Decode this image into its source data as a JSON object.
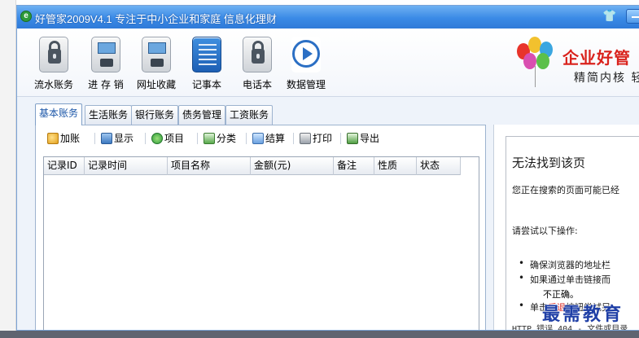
{
  "window": {
    "title": "好管家2009V4.1 专注于中小企业和家庭 信息化理财",
    "logo_letter": "e"
  },
  "toolbar": {
    "items": [
      {
        "label": "流水账务",
        "icon": "lock-icon"
      },
      {
        "label": "进 存 销",
        "icon": "storage-icon"
      },
      {
        "label": "网址收藏",
        "icon": "storage-icon"
      },
      {
        "label": "记事本",
        "icon": "notebook-icon"
      },
      {
        "label": "电话本",
        "icon": "lock-icon"
      },
      {
        "label": "数据管理",
        "icon": "play-icon"
      }
    ]
  },
  "brand": {
    "name": "企业好管",
    "slogan": "精简内核 轻"
  },
  "tabs": [
    {
      "label": "基本账务",
      "active": true
    },
    {
      "label": "生活账务",
      "active": false
    },
    {
      "label": "银行账务",
      "active": false
    },
    {
      "label": "债务管理",
      "active": false
    },
    {
      "label": "工资账务",
      "active": false
    }
  ],
  "subtoolbar": {
    "items": [
      {
        "label": "加账",
        "icon": "add-icon"
      },
      {
        "label": "显示",
        "icon": "display-icon"
      },
      {
        "label": "项目",
        "icon": "refresh-icon"
      },
      {
        "label": "分类",
        "icon": "excel-icon"
      },
      {
        "label": "结算",
        "icon": "settle-icon"
      },
      {
        "label": "打印",
        "icon": "print-icon"
      },
      {
        "label": "导出",
        "icon": "export-icon"
      }
    ]
  },
  "grid": {
    "columns": [
      "记录ID",
      "记录时间",
      "项目名称",
      "金额(元)",
      "备注",
      "性质",
      "状态"
    ]
  },
  "browser": {
    "error_title": "无法找到该页",
    "error_desc": "您正在搜索的页面可能已经",
    "try_text": "请尝试以下操作:",
    "bullets": [
      "确保浏览器的地址栏",
      "如果通过单击链接而",
      "单击后退按钮尝试另"
    ],
    "bullet2_cont": "不正确。",
    "back_word": "后退",
    "http_text": "HTTP 错误 404 - 文件或目录"
  },
  "watermark": "最需教育"
}
